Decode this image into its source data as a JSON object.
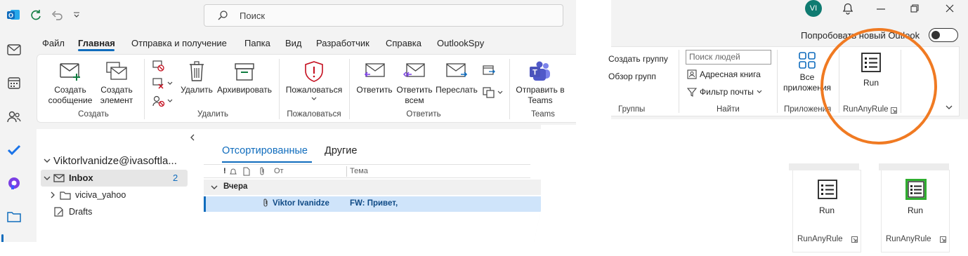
{
  "title_bar": {
    "search_placeholder": "Поиск",
    "avatar_initials": "VI"
  },
  "menu": {
    "tabs": [
      "Файл",
      "Главная",
      "Отправка и получение",
      "Папка",
      "Вид",
      "Разработчик",
      "Справка",
      "OutlookSpy"
    ],
    "active_tab": "Главная"
  },
  "ribbon": {
    "new_message": "Создать сообщение",
    "new_item": "Создать элемент",
    "group_create": "Создать",
    "delete": "Удалить",
    "archive": "Архивировать",
    "group_delete": "Удалить",
    "report": "Пожаловаться",
    "group_report": "Пожаловаться",
    "reply": "Ответить",
    "reply_all": "Ответить всем",
    "forward": "Переслать",
    "group_respond": "Ответить",
    "send_teams": "Отправить в Teams",
    "group_teams": "Teams"
  },
  "folder_pane": {
    "account": "Viktorlvanidze@ivasoftla...",
    "inbox_label": "Inbox",
    "inbox_count": "2",
    "subfolder": "viciva_yahoo",
    "drafts": "Drafts"
  },
  "message_list": {
    "tab_focused": "Отсортированные",
    "tab_other": "Другие",
    "col_from": "От",
    "col_subject": "Тема",
    "group_yesterday": "Вчера",
    "row_sender": "Viktor Ivanidze",
    "row_subject": "FW: Привет,"
  },
  "right_panel": {
    "try_new_outlook": "Попробовать новый Outlook",
    "create_group": "Создать группу",
    "browse_groups": "Обзор групп",
    "group_groups": "Группы",
    "search_people_placeholder": "Поиск людей",
    "address_book": "Адресная книга",
    "filter_mail": "Фильтр почты",
    "group_find": "Найти",
    "all_apps": "Все приложения",
    "group_apps": "Приложения",
    "run_label": "Run",
    "run_group": "RunAnyRule"
  },
  "cards": [
    {
      "run_label": "Run",
      "group_label": "RunAnyRule"
    },
    {
      "run_label": "Run",
      "group_label": "RunAnyRule"
    }
  ],
  "colors": {
    "accent": "#0f6cbd",
    "highlight_circle": "#f07a22",
    "selected_row": "#cfe4fa"
  }
}
